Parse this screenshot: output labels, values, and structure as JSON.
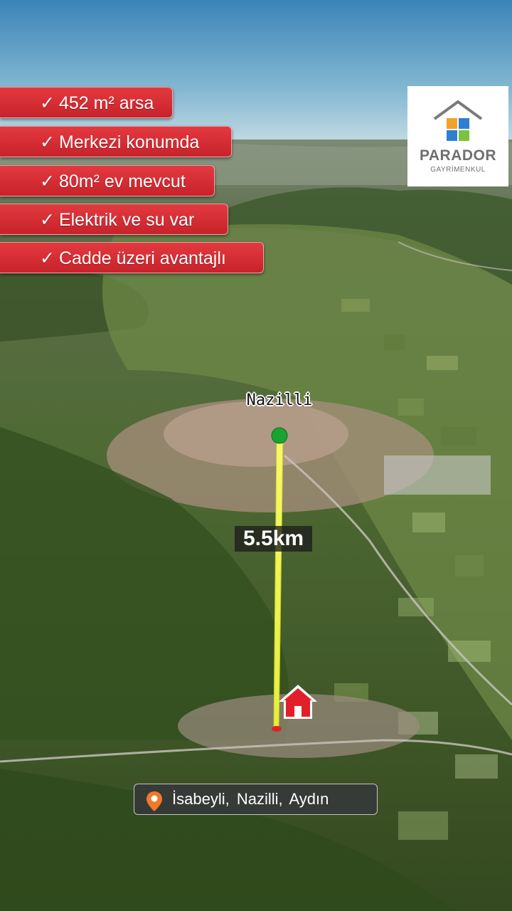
{
  "features": [
    {
      "check": "✓",
      "text": "452 m² arsa"
    },
    {
      "check": "✓",
      "text": "Merkezi konumda"
    },
    {
      "check": "✓",
      "text": "80m² ev mevcut"
    },
    {
      "check": "✓",
      "text": "Elektrik ve su var"
    },
    {
      "check": "✓",
      "text": "Cadde üzeri avantajlı"
    }
  ],
  "logo": {
    "name": "PARADOR",
    "subtitle": "GAYRİMENKUL"
  },
  "map": {
    "city_label": "Nazilli",
    "distance_label": "5.5km",
    "location_label": "İsabeyli,  Nazilli,  Aydın",
    "icons": [
      "location-pin-icon",
      "house-icon",
      "city-marker-dot",
      "distance-line"
    ]
  },
  "colors": {
    "feature_badge": "#d42a31",
    "distance_line": "#f1f14a",
    "city_dot": "#1aa331",
    "house_marker": "#e2202a",
    "pin": "#f07a2a"
  }
}
